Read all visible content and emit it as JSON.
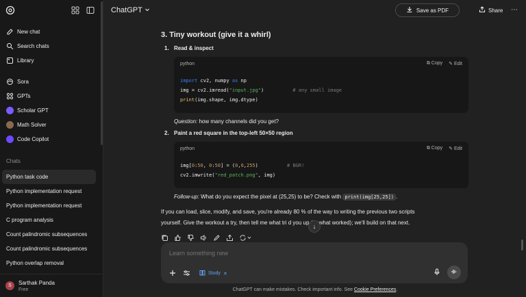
{
  "sidebar": {
    "nav": [
      {
        "label": "New chat",
        "icon": "new-chat-icon"
      },
      {
        "label": "Search chats",
        "icon": "search-icon"
      },
      {
        "label": "Library",
        "icon": "library-icon"
      }
    ],
    "gpts": [
      {
        "label": "Sora",
        "icon": "sora-icon"
      },
      {
        "label": "GPTs",
        "icon": "grid-icon"
      },
      {
        "label": "Scholar GPT",
        "color": "#7c5cff"
      },
      {
        "label": "Math Solver",
        "color": "#8a6a4a"
      },
      {
        "label": "Code Copilot",
        "color": "#6d4aff"
      }
    ],
    "chats_heading": "Chats",
    "chats": [
      "Python task code",
      "Python implementation request",
      "Python implementation request",
      "C program analysis",
      "Count palindromic subsequences",
      "Count palindromic subsequences",
      "Python overlap removal"
    ],
    "user": {
      "initial": "S",
      "name": "Sarthak Panda",
      "plan": "Free"
    }
  },
  "header": {
    "model": "ChatGPT",
    "save_pdf": "Save as PDF",
    "share": "Share"
  },
  "content": {
    "heading": "3. Tiny workout (give it a whirl)",
    "step1": {
      "num": "1.",
      "title": "Read & inspect"
    },
    "code1": {
      "lang": "python",
      "copy": "Copy",
      "edit": "Edit"
    },
    "question_label": "Question:",
    "question_text": " how many channels did you get?",
    "step2": {
      "num": "2.",
      "title": "Paint a red square in the top-left 50×50 region"
    },
    "code2": {
      "lang": "python",
      "copy": "Copy",
      "edit": "Edit"
    },
    "followup_label": "Follow-up:",
    "followup_text": " What do you expect the pixel at (25,25) to be? Check with ",
    "followup_code": "print(img[25,25])",
    "followup_end": ".",
    "closing_line1": "If you can load, slice, modify, and save, you're already 80 % of the way to writing the previous two scripts",
    "closing_line2": "yourself. Give the workout a try, then tell me what tri   d you up (or what worked); we'll build on that next."
  },
  "composer": {
    "placeholder": "Learn something new",
    "study": "Study"
  },
  "disclaimer": {
    "text": "ChatGPT can make mistakes. Check important info. See ",
    "link": "Cookie Preferences",
    "end": "."
  }
}
